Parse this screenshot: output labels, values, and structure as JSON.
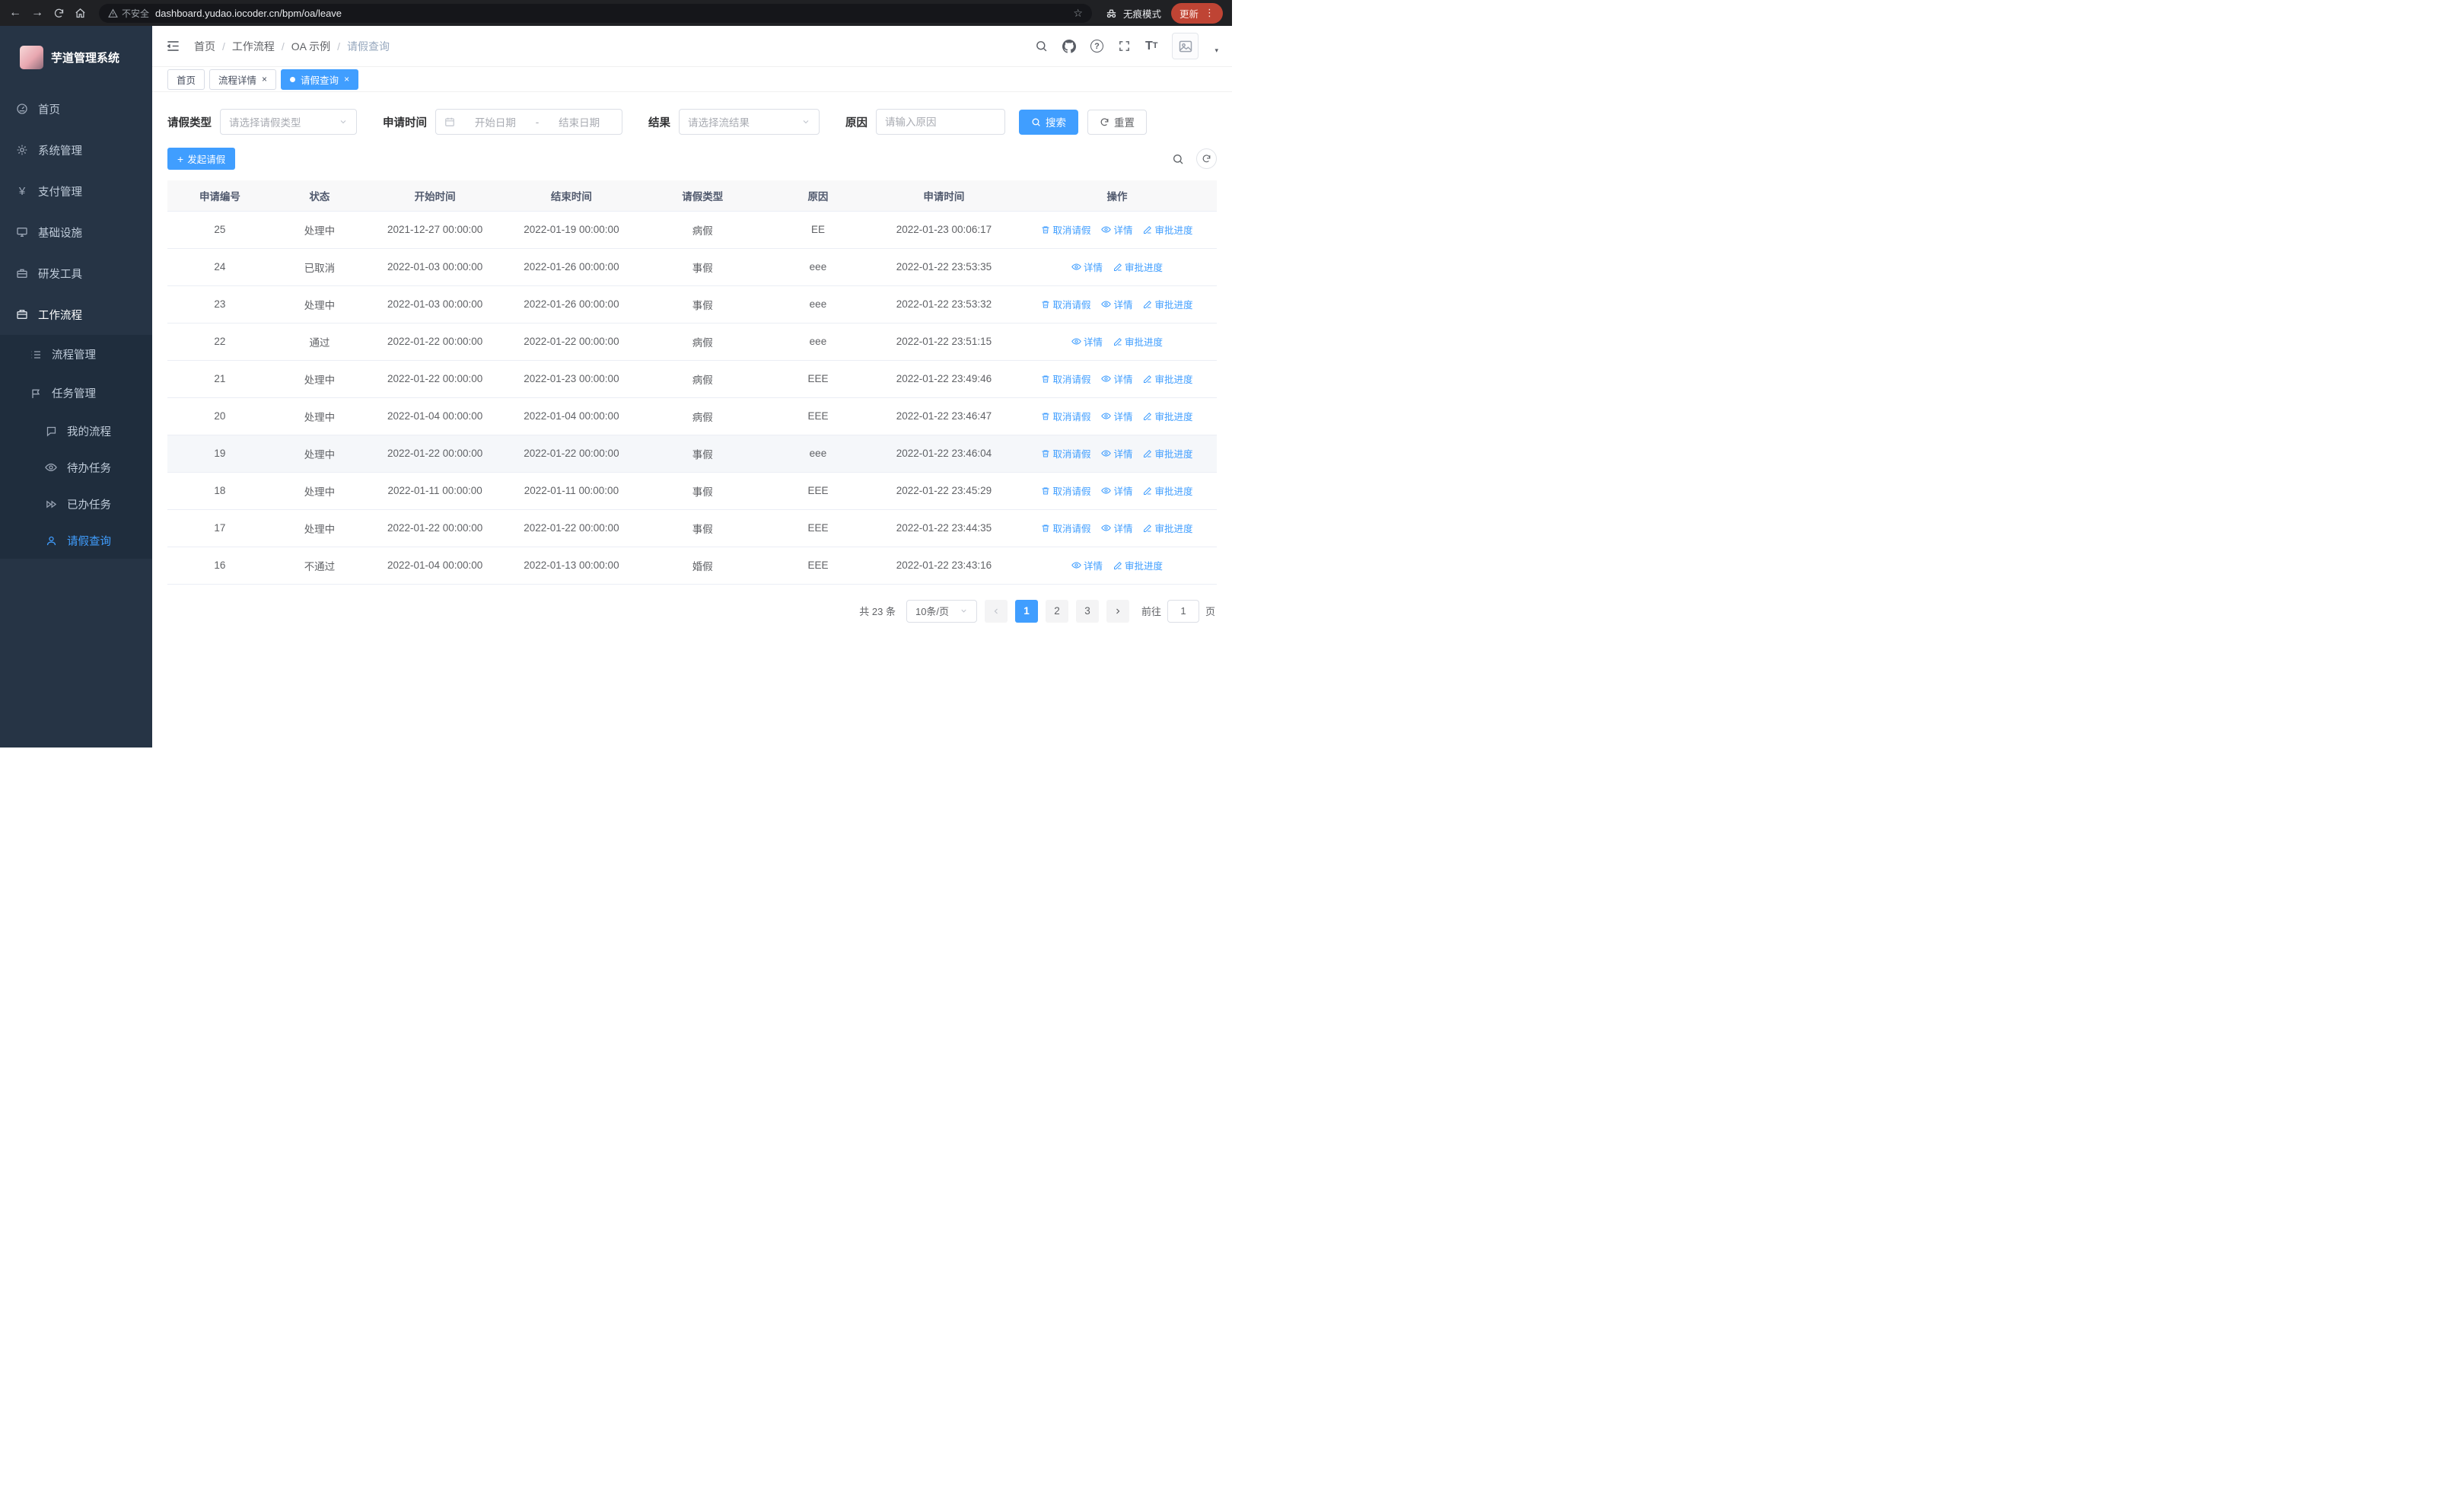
{
  "colors": {
    "primary": "#409eff",
    "sidebar_bg": "#263445",
    "submenu_bg": "#1f2d3d",
    "active_tab_bg": "#409eff"
  },
  "browser": {
    "security_label": "不安全",
    "url": "dashboard.yudao.iocoder.cn/bpm/oa/leave",
    "incognito_label": "无痕模式",
    "update_label": "更新"
  },
  "sidebar": {
    "title": "芋道管理系统",
    "menu": [
      {
        "label": "首页"
      },
      {
        "label": "系统管理"
      },
      {
        "label": "支付管理"
      },
      {
        "label": "基础设施"
      },
      {
        "label": "研发工具"
      },
      {
        "label": "工作流程"
      }
    ],
    "workflow_children": [
      {
        "label": "流程管理"
      },
      {
        "label": "任务管理"
      }
    ],
    "task_children": [
      {
        "label": "我的流程"
      },
      {
        "label": "待办任务"
      },
      {
        "label": "已办任务"
      },
      {
        "label": "请假查询"
      }
    ]
  },
  "header": {
    "breadcrumb": [
      {
        "label": "首页"
      },
      {
        "label": "工作流程"
      },
      {
        "label": "OA 示例"
      },
      {
        "label": "请假查询"
      }
    ]
  },
  "tabs": [
    {
      "label": "首页"
    },
    {
      "label": "流程详情"
    },
    {
      "label": "请假查询"
    }
  ],
  "filters": {
    "leave_type_label": "请假类型",
    "leave_type_placeholder": "请选择请假类型",
    "apply_time_label": "申请时间",
    "start_date_placeholder": "开始日期",
    "date_separator": "-",
    "end_date_placeholder": "结束日期",
    "result_label": "结果",
    "result_placeholder": "请选择流结果",
    "reason_label": "原因",
    "reason_placeholder": "请输入原因",
    "search_label": "搜索",
    "reset_label": "重置"
  },
  "toolbar": {
    "create_label": "发起请假"
  },
  "table": {
    "columns": [
      "申请编号",
      "状态",
      "开始时间",
      "结束时间",
      "请假类型",
      "原因",
      "申请时间",
      "操作"
    ],
    "actions": {
      "cancel": "取消请假",
      "detail": "详情",
      "progress": "审批进度"
    },
    "rows": [
      {
        "id": "25",
        "status": "处理中",
        "start": "2021-12-27 00:00:00",
        "end": "2022-01-19 00:00:00",
        "type": "病假",
        "reason": "EE",
        "applied": "2022-01-23 00:06:17",
        "cancellable": true,
        "highlight": false
      },
      {
        "id": "24",
        "status": "已取消",
        "start": "2022-01-03 00:00:00",
        "end": "2022-01-26 00:00:00",
        "type": "事假",
        "reason": "eee",
        "applied": "2022-01-22 23:53:35",
        "cancellable": false,
        "highlight": false
      },
      {
        "id": "23",
        "status": "处理中",
        "start": "2022-01-03 00:00:00",
        "end": "2022-01-26 00:00:00",
        "type": "事假",
        "reason": "eee",
        "applied": "2022-01-22 23:53:32",
        "cancellable": true,
        "highlight": false
      },
      {
        "id": "22",
        "status": "通过",
        "start": "2022-01-22 00:00:00",
        "end": "2022-01-22 00:00:00",
        "type": "病假",
        "reason": "eee",
        "applied": "2022-01-22 23:51:15",
        "cancellable": false,
        "highlight": false
      },
      {
        "id": "21",
        "status": "处理中",
        "start": "2022-01-22 00:00:00",
        "end": "2022-01-23 00:00:00",
        "type": "病假",
        "reason": "EEE",
        "applied": "2022-01-22 23:49:46",
        "cancellable": true,
        "highlight": false
      },
      {
        "id": "20",
        "status": "处理中",
        "start": "2022-01-04 00:00:00",
        "end": "2022-01-04 00:00:00",
        "type": "病假",
        "reason": "EEE",
        "applied": "2022-01-22 23:46:47",
        "cancellable": true,
        "highlight": false
      },
      {
        "id": "19",
        "status": "处理中",
        "start": "2022-01-22 00:00:00",
        "end": "2022-01-22 00:00:00",
        "type": "事假",
        "reason": "eee",
        "applied": "2022-01-22 23:46:04",
        "cancellable": true,
        "highlight": true
      },
      {
        "id": "18",
        "status": "处理中",
        "start": "2022-01-11 00:00:00",
        "end": "2022-01-11 00:00:00",
        "type": "事假",
        "reason": "EEE",
        "applied": "2022-01-22 23:45:29",
        "cancellable": true,
        "highlight": false
      },
      {
        "id": "17",
        "status": "处理中",
        "start": "2022-01-22 00:00:00",
        "end": "2022-01-22 00:00:00",
        "type": "事假",
        "reason": "EEE",
        "applied": "2022-01-22 23:44:35",
        "cancellable": true,
        "highlight": false
      },
      {
        "id": "16",
        "status": "不通过",
        "start": "2022-01-04 00:00:00",
        "end": "2022-01-13 00:00:00",
        "type": "婚假",
        "reason": "EEE",
        "applied": "2022-01-22 23:43:16",
        "cancellable": false,
        "highlight": false
      }
    ]
  },
  "pagination": {
    "total": "共 23 条",
    "page_size": "10条/页",
    "pages": [
      "1",
      "2",
      "3"
    ],
    "active_page": "1",
    "goto": "前往",
    "goto_value": "1",
    "unit": "页"
  }
}
